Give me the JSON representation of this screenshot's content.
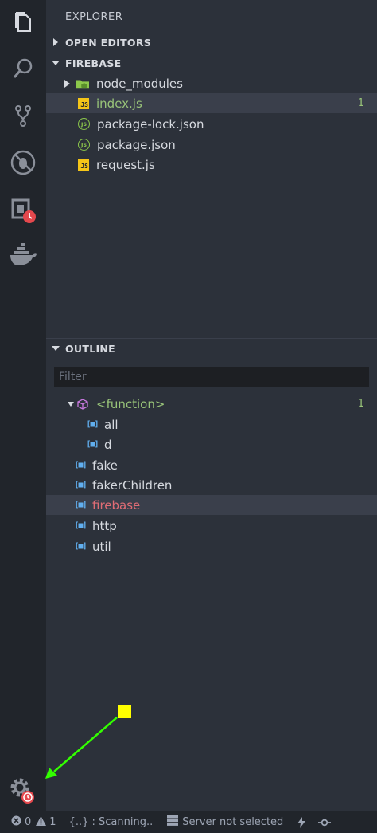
{
  "sidebar": {
    "title": "EXPLORER",
    "open_editors": {
      "label": "OPEN EDITORS"
    },
    "folder": {
      "label": "FIREBASE",
      "items": [
        {
          "name": "node_modules",
          "type": "folder",
          "icon": "node-folder-icon"
        },
        {
          "name": "index.js",
          "type": "js",
          "icon": "js-file-icon",
          "badge": "1"
        },
        {
          "name": "package-lock.json",
          "type": "json",
          "icon": "node-json-icon"
        },
        {
          "name": "package.json",
          "type": "json",
          "icon": "node-json-icon"
        },
        {
          "name": "request.js",
          "type": "js",
          "icon": "js-file-icon"
        }
      ]
    },
    "outline": {
      "label": "OUTLINE",
      "filter_placeholder": "Filter",
      "items": [
        {
          "name": "<function>",
          "kind": "function",
          "icon": "cube-icon",
          "badge": "1"
        },
        {
          "name": "all",
          "kind": "variable",
          "icon": "variable-icon"
        },
        {
          "name": "d",
          "kind": "variable",
          "icon": "variable-icon"
        },
        {
          "name": "fake",
          "kind": "variable",
          "icon": "variable-icon"
        },
        {
          "name": "fakerChildren",
          "kind": "variable",
          "icon": "variable-icon"
        },
        {
          "name": "firebase",
          "kind": "variable",
          "icon": "variable-icon"
        },
        {
          "name": "http",
          "kind": "variable",
          "icon": "variable-icon"
        },
        {
          "name": "util",
          "kind": "variable",
          "icon": "variable-icon"
        }
      ]
    }
  },
  "activity_bar": {
    "icons": [
      "files-icon",
      "search-icon",
      "source-control-icon",
      "debug-icon",
      "extensions-icon",
      "docker-icon"
    ],
    "bottom_icon": "settings-gear-icon"
  },
  "status_bar": {
    "errors": "0",
    "warnings": "1",
    "scanning": "{..} : Scanning..",
    "server": "Server not selected"
  },
  "colors": {
    "accent_green": "#98c379",
    "error_red": "#e06c75",
    "callout_yellow": "#ffff00",
    "arrow_green": "#33ff00"
  }
}
